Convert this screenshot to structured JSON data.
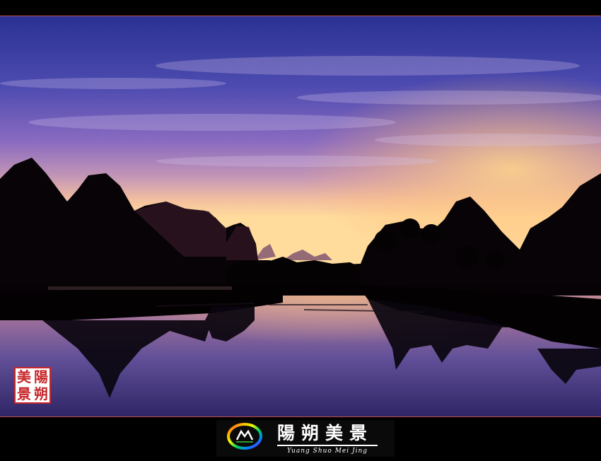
{
  "photo": {
    "subject": "karst-mountains-river-sunset",
    "colors": {
      "sky_top": "#27318f",
      "sky_mid": "#6a54b8",
      "sky_low": "#c08fb6",
      "horizon": "#ffd39a",
      "silhouette": "#050204",
      "water_top": "#f0b3a8",
      "water_bottom": "#3d2f80"
    }
  },
  "seal": {
    "chars": [
      "美",
      "陽",
      "景",
      "朔"
    ],
    "color": "#c8262a"
  },
  "footer": {
    "logo_icon": "rainbow-m-logo-icon",
    "title_cn": "陽朔美景",
    "title_en": "Yuang Shuo Mei Jing"
  }
}
